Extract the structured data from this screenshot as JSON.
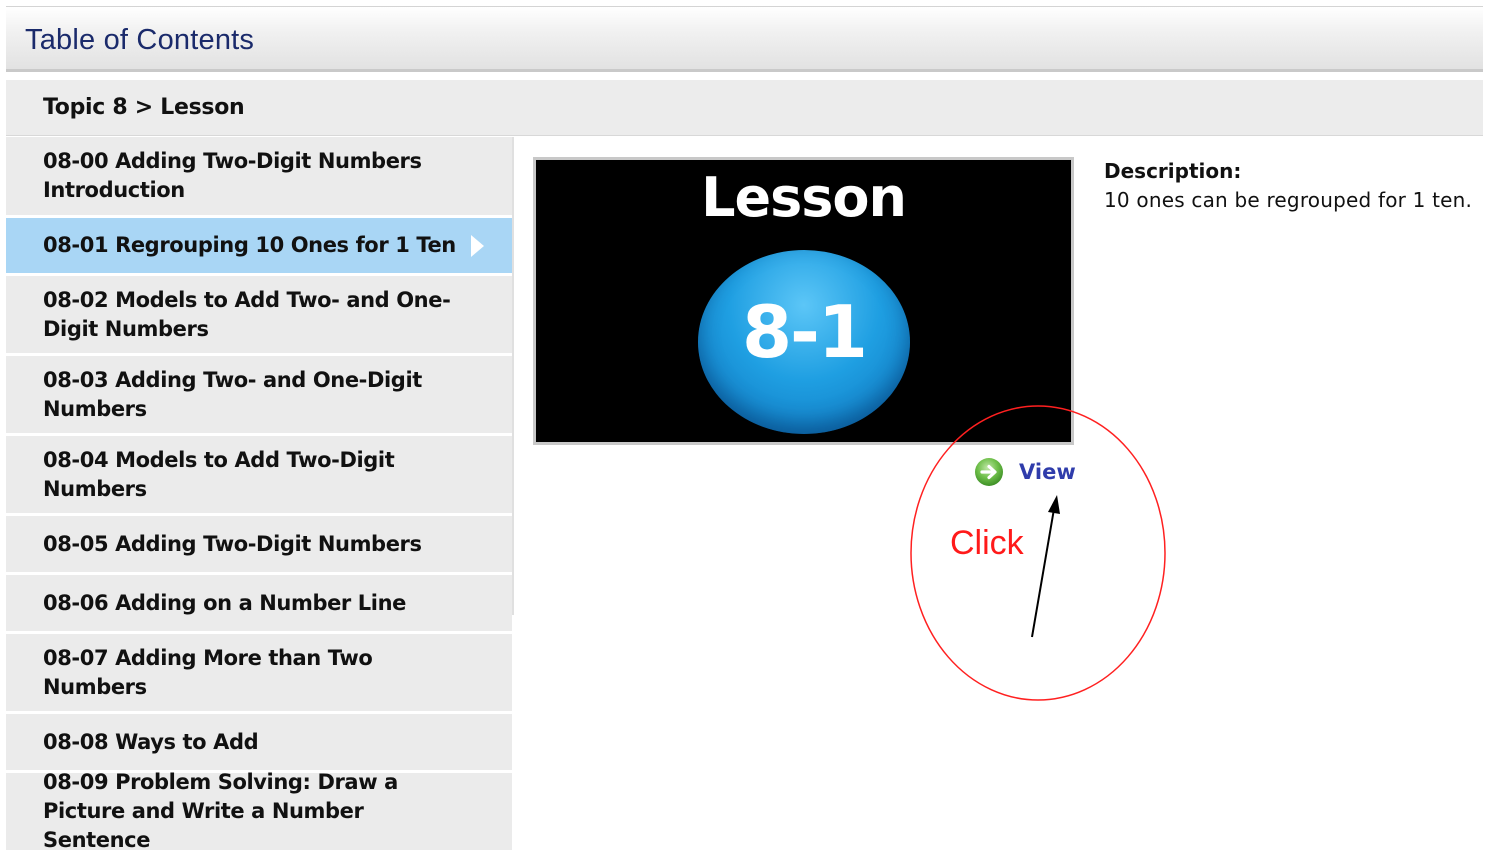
{
  "header": {
    "title": "Table of Contents"
  },
  "breadcrumb": {
    "topic": "Topic 8",
    "separator": " > ",
    "current": "Lesson"
  },
  "sidebar": {
    "items": [
      {
        "label": "08-00 Adding Two-Digit Numbers Introduction",
        "active": false
      },
      {
        "label": "08-01 Regrouping 10 Ones for 1 Ten",
        "active": true
      },
      {
        "label": "08-02 Models to Add Two- and One-Digit Numbers",
        "active": false
      },
      {
        "label": "08-03 Adding Two- and One-Digit Numbers",
        "active": false
      },
      {
        "label": "08-04 Models to Add Two-Digit Numbers",
        "active": false
      },
      {
        "label": "08-05 Adding Two-Digit Numbers",
        "active": false
      },
      {
        "label": "08-06 Adding on a Number Line",
        "active": false
      },
      {
        "label": "08-07 Adding More than Two Numbers",
        "active": false
      },
      {
        "label": "08-08 Ways to Add",
        "active": false
      },
      {
        "label": "08-09 Problem Solving: Draw a Picture and Write a Number Sentence",
        "active": false
      }
    ]
  },
  "main": {
    "thumbnail": {
      "word": "Lesson",
      "number": "8-1"
    },
    "view_label": "View",
    "description_label": "Description:",
    "description_text": "10 ones can be regrouped for 1 ten."
  },
  "annotation": {
    "text": "Click"
  },
  "colors": {
    "active_item": "#a9d6f5",
    "title_text": "#1a2a6b",
    "view_link": "#2f3cab",
    "annotation": "#ff1a1a"
  }
}
